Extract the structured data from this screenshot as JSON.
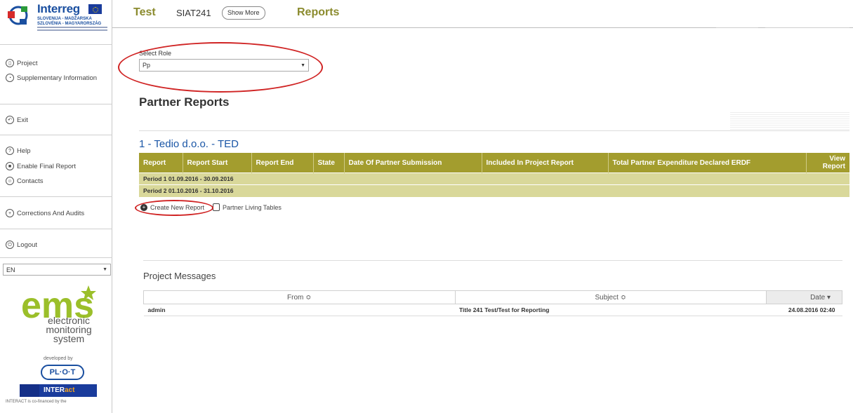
{
  "logo": {
    "brand": "Interreg",
    "line1": "SLOVENIJA - MADŽARSKA",
    "line2": "SZLOVÉNIA - MAGYARORSZÁG"
  },
  "header": {
    "project": "Test",
    "code": "SIAT241",
    "show_more": "Show More",
    "section": "Reports"
  },
  "sidebar": {
    "items": [
      {
        "label": "Project",
        "icon": "project-icon"
      },
      {
        "label": "Supplementary Information",
        "icon": "info-icon"
      },
      {
        "label": "Exit",
        "icon": "exit-icon"
      },
      {
        "label": "Help",
        "icon": "help-icon"
      },
      {
        "label": "Enable Final Report",
        "icon": "report-icon"
      },
      {
        "label": "Contacts",
        "icon": "contacts-icon"
      },
      {
        "label": "Corrections And Audits",
        "icon": "plus-icon"
      },
      {
        "label": "Logout",
        "icon": "power-icon"
      }
    ],
    "language": "EN"
  },
  "ems": {
    "line1": "electronic",
    "line2": "monitoring",
    "line3": "system",
    "developed_by": "developed by",
    "plot": "PL·O·T",
    "interact_a": "INTER",
    "interact_b": "act",
    "cofinanced": "INTERACT is co-financed by the"
  },
  "main": {
    "role_label": "Select Role",
    "role_value": "Pp",
    "title": "Partner Reports",
    "partner_name": "1 - Tedio d.o.o. - TED",
    "table": {
      "headers": [
        "Report",
        "Report Start",
        "Report End",
        "State",
        "Date Of Partner Submission",
        "Included In Project Report",
        "Total Partner Expenditure Declared ERDF",
        "View Report"
      ],
      "rows": [
        "Period 1 01.09.2016 - 30.09.2016",
        "Period 2 01.10.2016 - 31.10.2016"
      ]
    },
    "create_report": "Create New Report",
    "living_tables": "Partner Living Tables"
  },
  "messages": {
    "title": "Project Messages",
    "headers": {
      "from": "From ≎",
      "subject": "Subject ≎",
      "date": "Date ▾"
    },
    "rows": [
      {
        "from": "admin",
        "subject": "Title 241 Test/Test for Reporting",
        "date": "24.08.2016 02:40"
      }
    ]
  },
  "colors": {
    "accent": "#a39d2e",
    "row_bg": "#d9d89a",
    "title_olive": "#8b8b2e",
    "link_blue": "#1a56a6",
    "annotation_red": "#d02424"
  }
}
